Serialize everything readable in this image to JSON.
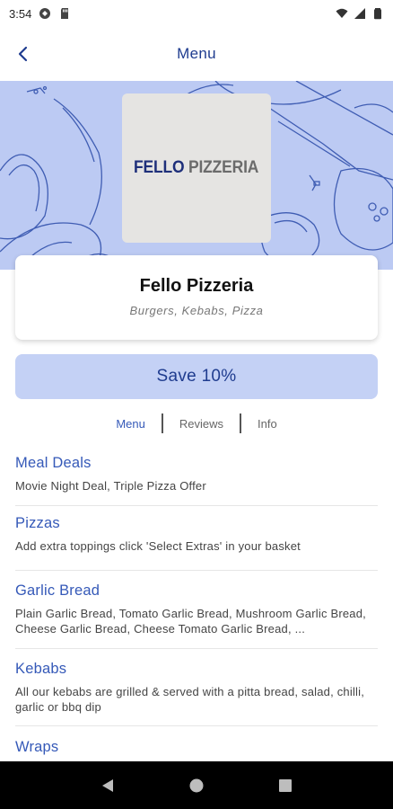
{
  "status_bar": {
    "time": "3:54",
    "icons": [
      "circle-app-icon",
      "sd-card-icon",
      "wifi-icon",
      "signal-icon",
      "battery-icon"
    ]
  },
  "app_bar": {
    "title": "Menu",
    "back_icon": "chevron-left-icon"
  },
  "colors": {
    "accent": "#3559b8",
    "title_blue": "#1f3c8f",
    "banner_bg": "#bccaf3",
    "save_bg": "#c4d1f5",
    "nav_bg": "#000000"
  },
  "logo": {
    "text_a": "FELLO",
    "text_b": "PIZZERIA"
  },
  "restaurant": {
    "name": "Fello Pizzeria",
    "cuisines": "Burgers, Kebabs, Pizza"
  },
  "offer": {
    "label": "Save 10%"
  },
  "tabs": [
    {
      "label": "Menu",
      "active": true
    },
    {
      "label": "Reviews",
      "active": false
    },
    {
      "label": "Info",
      "active": false
    }
  ],
  "menu": {
    "categories": [
      {
        "title": "Meal Deals",
        "description": "Movie Night Deal, Triple Pizza Offer"
      },
      {
        "title": "Pizzas",
        "description": "Add extra toppings click 'Select Extras' in your basket"
      },
      {
        "title": "Garlic Bread",
        "description": "Plain Garlic Bread, Tomato Garlic Bread, Mushroom Garlic Bread, Cheese Garlic Bread, Cheese Tomato Garlic Bread, ..."
      },
      {
        "title": "Kebabs",
        "description": "All our kebabs are grilled & served with a pitta bread, salad, chilli, garlic or bbq dip"
      },
      {
        "title": "Wraps",
        "description": ""
      }
    ]
  },
  "nav_bar": {
    "buttons": [
      "back-triangle-icon",
      "home-circle-icon",
      "recents-square-icon"
    ]
  }
}
